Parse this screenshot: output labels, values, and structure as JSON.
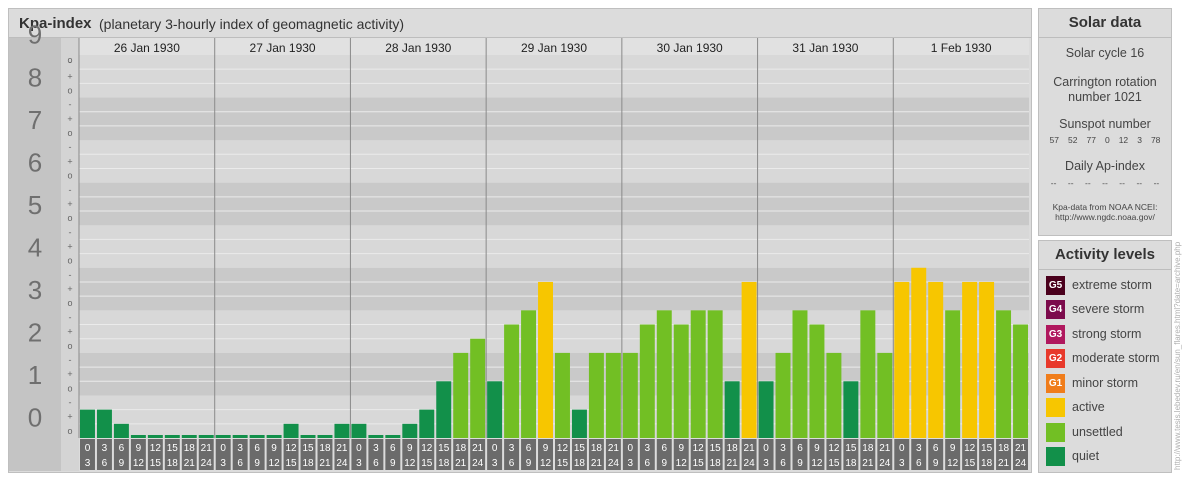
{
  "title": {
    "main": "Kpa-index",
    "subtitle": "(planetary 3-hourly index of geomagnetic activity)"
  },
  "chart_data": {
    "type": "bar",
    "ylim": [
      0,
      9
    ],
    "y_ticks": [
      "0",
      "1",
      "2",
      "3",
      "4",
      "5",
      "6",
      "7",
      "8",
      "9"
    ],
    "minor_tick_labels": [
      "o",
      "+",
      "-"
    ],
    "days": [
      "26 Jan 1930",
      "27 Jan 1930",
      "28 Jan 1930",
      "29 Jan 1930",
      "30 Jan 1930",
      "31 Jan 1930",
      "1 Feb 1930"
    ],
    "interval_starts": [
      "0",
      "3",
      "6",
      "9",
      "12",
      "15",
      "18",
      "21"
    ],
    "interval_ends": [
      "3",
      "6",
      "9",
      "12",
      "15",
      "18",
      "21",
      "24"
    ],
    "values": [
      [
        0.667,
        0.667,
        0.333,
        0,
        0,
        0,
        0,
        0
      ],
      [
        0,
        0,
        0,
        0,
        0.333,
        0,
        0,
        0.333
      ],
      [
        0.333,
        0,
        0,
        0.333,
        0.667,
        1.333,
        2,
        2.333
      ],
      [
        1.333,
        2.667,
        3,
        3.667,
        2,
        0.667,
        2,
        2
      ],
      [
        2,
        2.667,
        3,
        2.667,
        3,
        3,
        1.333,
        3.667
      ],
      [
        1.333,
        2,
        3,
        2.667,
        2,
        1.333,
        3,
        2
      ],
      [
        3.667,
        4,
        3.667,
        3,
        3.667,
        3.667,
        3,
        2.667
      ]
    ],
    "colors": {
      "quiet": "#12904a",
      "unsettled": "#72bf24",
      "active": "#f7c600",
      "minor_storm": "#f07d1b",
      "moderate_storm": "#e8392b",
      "strong_storm": "#b0185e",
      "severe_storm": "#7c0b4c",
      "extreme_storm": "#4a001c"
    }
  },
  "solar": {
    "title": "Solar data",
    "cycle": "Solar cycle 16",
    "carrington_line1": "Carrington rotation",
    "carrington_line2": "number 1021",
    "sunspot_label": "Sunspot number",
    "sunspots": [
      "57",
      "52",
      "77",
      "0",
      "12",
      "3",
      "78"
    ],
    "ap_label": "Daily Ap-index",
    "ap_values": [
      "--",
      "--",
      "--",
      "--",
      "--",
      "--",
      "--"
    ],
    "credit_line1": "Kpa-data from NOAA NCEI:",
    "credit_line2": "http://www.ngdc.noaa.gov/"
  },
  "levels": {
    "title": "Activity levels",
    "items": [
      {
        "badge": "G5",
        "label": "extreme storm",
        "color": "#4a001c"
      },
      {
        "badge": "G4",
        "label": "severe storm",
        "color": "#7c0b4c"
      },
      {
        "badge": "G3",
        "label": "strong storm",
        "color": "#b0185e"
      },
      {
        "badge": "G2",
        "label": "moderate storm",
        "color": "#e8392b"
      },
      {
        "badge": "G1",
        "label": "minor storm",
        "color": "#f07d1b"
      },
      {
        "badge": "",
        "label": "active",
        "color": "#f7c600"
      },
      {
        "badge": "",
        "label": "unsettled",
        "color": "#72bf24"
      },
      {
        "badge": "",
        "label": "quiet",
        "color": "#12904a"
      }
    ]
  },
  "watermark": "http://www.tesis.lebedev.ru/en/sun_flares.html?date=archive.php"
}
